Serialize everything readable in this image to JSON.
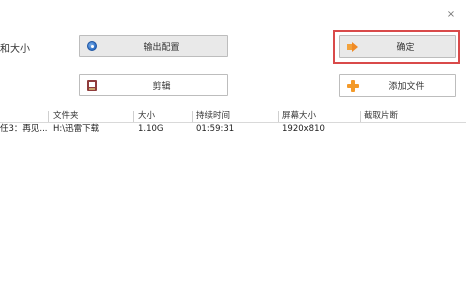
{
  "window": {
    "close_glyph": "×"
  },
  "left_partial_label": "和大小",
  "buttons": {
    "output_config": {
      "label": "输出配置",
      "icon": "disc-icon"
    },
    "confirm": {
      "label": "确定",
      "icon": "arrow-right-icon"
    },
    "edit": {
      "label": "剪辑",
      "icon": "film-edit-icon"
    },
    "add_file": {
      "label": "添加文件",
      "icon": "plus-icon"
    }
  },
  "table": {
    "columns": [
      "文件夹",
      "大小",
      "持续时间",
      "屏幕大小",
      "截取片断"
    ],
    "rows": [
      {
        "name": "任3：再见...",
        "folder": "H:\\迅雷下载",
        "size": "1.10G",
        "duration": "01:59:31",
        "resolution": "1920x810",
        "clip": ""
      }
    ]
  },
  "colors": {
    "highlight_border": "#d94a4a",
    "button_bg": "#e9e9e9",
    "button_border": "#bdbdbd",
    "accent_orange": "#f39a2a"
  }
}
